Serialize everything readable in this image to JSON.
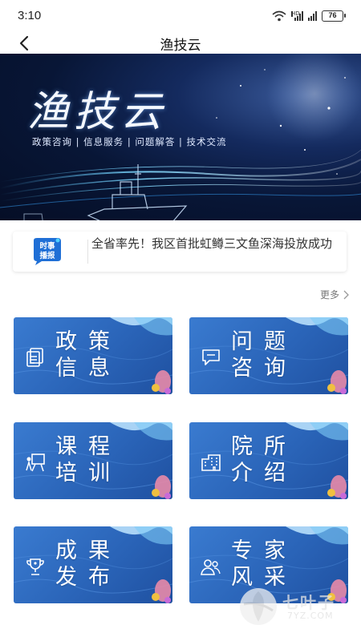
{
  "status_bar": {
    "time": "3:10",
    "battery": "76",
    "network_label": "HD"
  },
  "header": {
    "title": "渔技云"
  },
  "banner": {
    "title": "渔技云",
    "subtitle": "政策咨询 | 信息服务 | 问题解答 | 技术交流"
  },
  "news": {
    "badge_line1": "时事",
    "badge_line2": "播报",
    "headline": "全省率先！我区首批虹鳟三文鱼深海投放成功"
  },
  "more": {
    "label": "更多"
  },
  "cards": [
    {
      "line1": "政策",
      "line2": "信息",
      "icon": "document-icon"
    },
    {
      "line1": "问题",
      "line2": "咨询",
      "icon": "chat-icon"
    },
    {
      "line1": "课程",
      "line2": "培训",
      "icon": "easel-icon"
    },
    {
      "line1": "院所",
      "line2": "介绍",
      "icon": "building-icon"
    },
    {
      "line1": "成果",
      "line2": "发布",
      "icon": "trophy-icon"
    },
    {
      "line1": "专家",
      "line2": "风采",
      "icon": "people-icon"
    }
  ],
  "watermark": {
    "text": "七叶子",
    "sub": "7YZ.COM"
  },
  "colors": {
    "card_blue": "#2a64b8",
    "banner_dark": "#081636",
    "badge_blue": "#1f6fd6",
    "coral_pink": "#e88aa8",
    "coral_yellow": "#f0c040"
  }
}
